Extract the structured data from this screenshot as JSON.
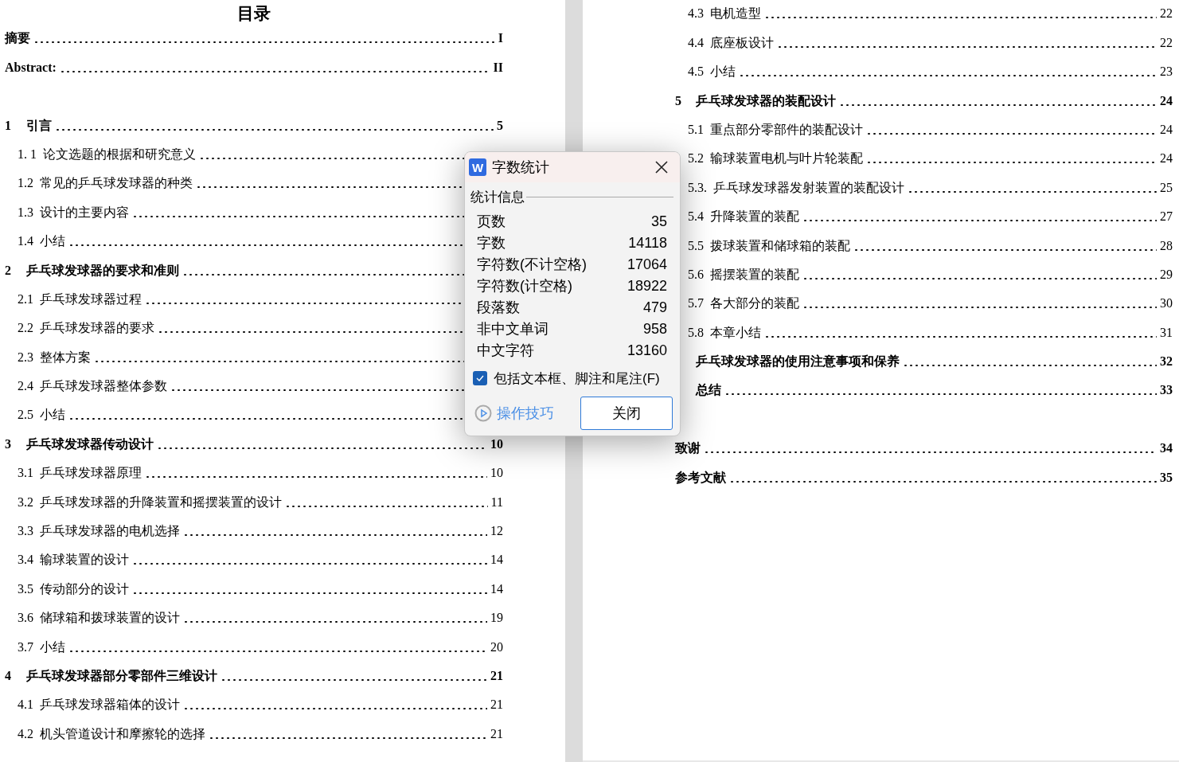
{
  "pages": [
    {
      "heading": "目录",
      "entry_groups": [
        [
          {
            "kind": "front",
            "title": "摘要",
            "page": "I"
          },
          {
            "kind": "front",
            "title": "Abstract:",
            "page": "II"
          }
        ],
        [
          {
            "kind": "chapter",
            "num": "1",
            "title": "引言",
            "page": "5"
          },
          {
            "kind": "section",
            "num": "1. 1",
            "title": "论文选题的根据和研究意义"
          },
          {
            "kind": "section",
            "num": "1.2",
            "title": "常见的乒乓球发球器的种类"
          },
          {
            "kind": "section",
            "num": "1.3",
            "title": "设计的主要内容"
          },
          {
            "kind": "section",
            "num": "1.4",
            "title": "小结"
          },
          {
            "kind": "chapter",
            "num": "2",
            "title": "乒乓球发球器的要求和准则"
          },
          {
            "kind": "section",
            "num": "2.1",
            "title": "乒乓球发球器过程"
          },
          {
            "kind": "section",
            "num": "2.2",
            "title": "乒乓球发球器的要求"
          },
          {
            "kind": "section",
            "num": "2.3",
            "title": "整体方案"
          },
          {
            "kind": "section",
            "num": "2.4",
            "title": "乒乓球发球器整体参数"
          },
          {
            "kind": "section",
            "num": "2.5",
            "title": "小结"
          },
          {
            "kind": "chapter",
            "num": "3",
            "title": "乒乓球发球器传动设计",
            "page": "10"
          },
          {
            "kind": "section",
            "num": "3.1",
            "title": "乒乓球发球器原理",
            "page": "10"
          },
          {
            "kind": "section",
            "num": "3.2",
            "title": "乒乓球发球器的升降装置和摇摆装置的设计",
            "page": "11"
          },
          {
            "kind": "section",
            "num": "3.3",
            "title": "乒乓球发球器的电机选择",
            "page": "12"
          },
          {
            "kind": "section",
            "num": "3.4",
            "title": "输球装置的设计",
            "page": "14"
          },
          {
            "kind": "section",
            "num": "3.5",
            "title": "传动部分的设计",
            "page": "14"
          },
          {
            "kind": "section",
            "num": "3.6",
            "title": "储球箱和拨球装置的设计",
            "page": "19"
          },
          {
            "kind": "section",
            "num": "3.7",
            "title": "小结",
            "page": "20"
          },
          {
            "kind": "chapter",
            "num": "4",
            "title": "乒乓球发球器部分零部件三维设计",
            "page": "21"
          },
          {
            "kind": "section",
            "num": "4.1",
            "title": "乒乓球发球器箱体的设计",
            "page": "21"
          },
          {
            "kind": "section",
            "num": "4.2",
            "title": "机头管道设计和摩擦轮的选择",
            "page": "21"
          }
        ]
      ]
    },
    {
      "entry_groups": [
        [
          {
            "kind": "section",
            "num": "4.3",
            "title": "电机造型",
            "page": "22"
          },
          {
            "kind": "section",
            "num": "4.4",
            "title": "底座板设计",
            "page": "22"
          },
          {
            "kind": "section",
            "num": "4.5",
            "title": "小结",
            "page": "23"
          },
          {
            "kind": "chapter",
            "num": "5",
            "title": "乒乓球发球器的装配设计",
            "page": "24"
          },
          {
            "kind": "section",
            "num": "5.1",
            "title": "重点部分零部件的装配设计",
            "page": "24"
          },
          {
            "kind": "section",
            "num": "5.2",
            "title": "输球装置电机与叶片轮装配",
            "page": "24"
          },
          {
            "kind": "section",
            "num": "5.3.",
            "title": "乒乓球发球器发射装置的装配设计",
            "page": "25"
          },
          {
            "kind": "section",
            "num": "5.4",
            "title": "升降装置的装配",
            "page": "27"
          },
          {
            "kind": "section",
            "num": "5.5",
            "title": "拨球装置和储球箱的装配",
            "page": "28"
          },
          {
            "kind": "section",
            "num": "5.6",
            "title": "摇摆装置的装配",
            "page": "29"
          },
          {
            "kind": "section",
            "num": "5.7",
            "title": "各大部分的装配",
            "page": "30"
          },
          {
            "kind": "section",
            "num": "5.8",
            "title": "本章小结",
            "page": "31"
          },
          {
            "kind": "chapter",
            "title": "乒乓球发球器的使用注意事项和保养",
            "page": "32"
          },
          {
            "kind": "chapter",
            "title": "总结",
            "page": "33"
          }
        ],
        [
          {
            "kind": "front",
            "title": "致谢",
            "page": "34"
          },
          {
            "kind": "front",
            "title": "参考文献",
            "page": "35"
          }
        ]
      ]
    }
  ],
  "dialog": {
    "logo_letter": "W",
    "title": "字数统计",
    "group_label": "统计信息",
    "stats": [
      {
        "label": "页数",
        "value": "35"
      },
      {
        "label": "字数",
        "value": "14118"
      },
      {
        "label": "字符数(不计空格)",
        "value": "17064"
      },
      {
        "label": "字符数(计空格)",
        "value": "18922"
      },
      {
        "label": "段落数",
        "value": "479"
      },
      {
        "label": "非中文单词",
        "value": "958"
      },
      {
        "label": "中文字符",
        "value": "13160"
      }
    ],
    "checkbox": {
      "label": "包括文本框、脚注和尾注(F)",
      "checked": true
    },
    "tips_link": "操作技巧",
    "close_button": "关闭"
  }
}
